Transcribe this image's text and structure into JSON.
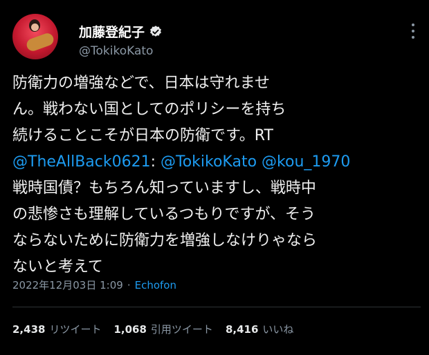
{
  "author": {
    "name": "加藤登紀子",
    "handle": "@TokikoKato"
  },
  "tweet": {
    "line1": "防衛力の増強などで、日本は守れませ",
    "line2": "ん。戦わない国としてのポリシーを持ち",
    "line3_text": "続けることこそが日本の防衛です。RT",
    "mention1": "@TheAllBack0621",
    "colon": ": ",
    "mention2": "@TokikoKato",
    "space": " ",
    "mention3": "@kou_1970",
    "line5": "戦時国債？もちろん知っていますし、戦時中",
    "line6": "の悲惨さも理解しているつもりですが、そう",
    "line7": "ならないために防衛力を増強しなけりゃなら",
    "line8": "ないと考えて"
  },
  "meta": {
    "timestamp": "2022年12月03日 1:09",
    "separator": "·",
    "source": "Echofon"
  },
  "stats": {
    "retweets_count": "2,438",
    "retweets_label": "リツイート",
    "quotes_count": "1,068",
    "quotes_label": "引用ツイート",
    "likes_count": "8,416",
    "likes_label": "いいね"
  },
  "colors": {
    "background": "#000000",
    "link": "#1d9bf0",
    "secondary": "#8b98a5",
    "verified": "#e7e9ea"
  },
  "icons": {
    "verified": "verified-badge-icon",
    "more": "more-options-icon"
  }
}
